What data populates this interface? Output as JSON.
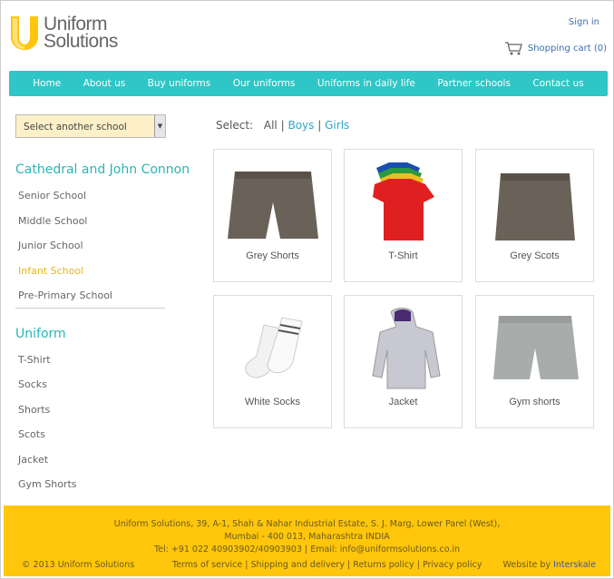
{
  "brand": {
    "line1": "Uniform",
    "line2": "Solutions",
    "accent": "#ffc60b"
  },
  "header": {
    "sign_in": "Sign in",
    "cart": "Shopping cart (0)",
    "cart_icon": "shopping-cart-icon"
  },
  "nav": [
    "Home",
    "About us",
    "Buy uniforms",
    "Our uniforms",
    "Uniforms in daily life",
    "Partner schools",
    "Contact us"
  ],
  "nav_color": "#2ec6c6",
  "sidebar": {
    "select": "Select another school",
    "school": "Cathedral and John Connon",
    "sections": [
      "Senior School",
      "Middle School",
      "Junior School",
      "Infant School",
      "Pre-Primary School"
    ],
    "active_section": "Infant School",
    "uniform_title": "Uniform",
    "uniform_items": [
      "T-Shirt",
      "Socks",
      "Shorts",
      "Scots",
      "Jacket",
      "Gym Shorts"
    ]
  },
  "filter": {
    "label": "Select:",
    "all": "All",
    "boys": "Boys",
    "girls": "Girls",
    "sep": "|"
  },
  "products": [
    "Grey Shorts",
    "T-Shirt",
    "Grey Scots",
    "White Socks",
    "Jacket",
    "Gym shorts"
  ],
  "footer": {
    "addr1": "Uniform Solutions, 39, A-1, Shah & Nahar Industrial Estate, S. J. Marg, Lower Parel (West),",
    "addr2": "Mumbai - 400 013, Maharashtra INDIA",
    "contact": "Tel: +91 022 40903902/40903903 | Email: info@uniformsolutions.co.in",
    "copyright": "© 2013 Uniform Solutions",
    "links": [
      "Terms of service",
      "Shipping and delivery",
      "Returns policy",
      "Privacy policy"
    ],
    "by": "Website by",
    "by_link": "Interskale"
  }
}
